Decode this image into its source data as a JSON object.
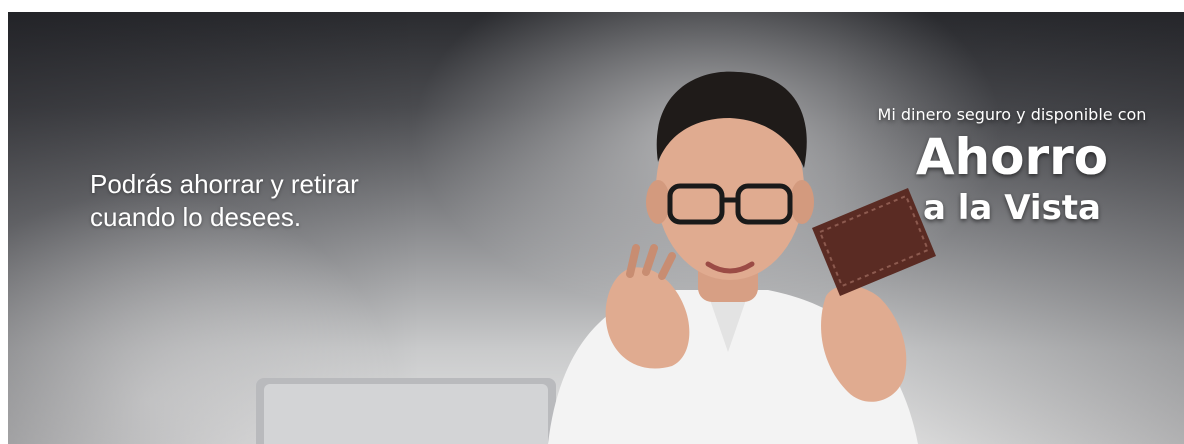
{
  "banner": {
    "left_text": {
      "line1": "Podrás ahorrar y retirar",
      "line2": "cuando lo desees."
    },
    "right_text": {
      "tagline": "Mi dinero seguro y disponible con",
      "brand": "Ahorro",
      "brand_sub": "a la Vista"
    }
  },
  "colors": {
    "text": "#ffffff",
    "shirt": "#f4f4f4",
    "wallet": "#5a2b23",
    "hair": "#1e1a18"
  }
}
